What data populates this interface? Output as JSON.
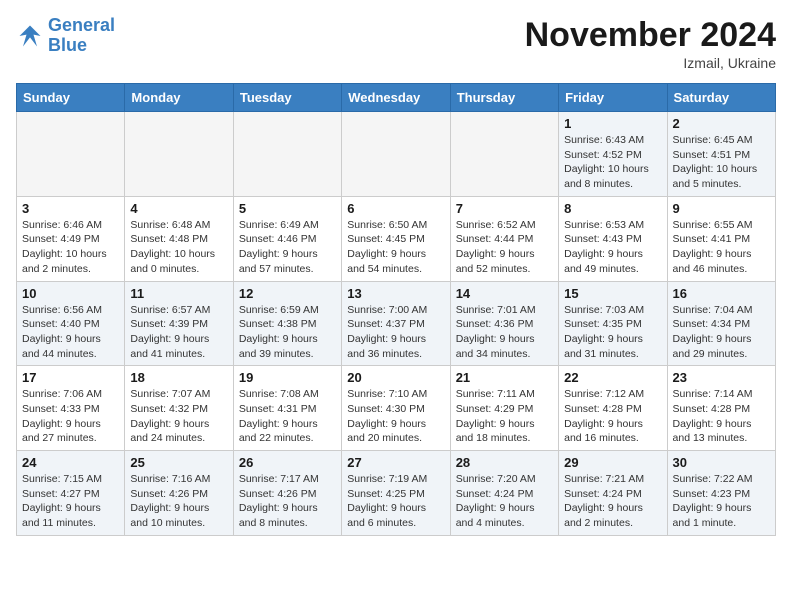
{
  "header": {
    "logo_line1": "General",
    "logo_line2": "Blue",
    "month": "November 2024",
    "location": "Izmail, Ukraine"
  },
  "weekdays": [
    "Sunday",
    "Monday",
    "Tuesday",
    "Wednesday",
    "Thursday",
    "Friday",
    "Saturday"
  ],
  "weeks": [
    [
      {
        "day": "",
        "info": ""
      },
      {
        "day": "",
        "info": ""
      },
      {
        "day": "",
        "info": ""
      },
      {
        "day": "",
        "info": ""
      },
      {
        "day": "",
        "info": ""
      },
      {
        "day": "1",
        "info": "Sunrise: 6:43 AM\nSunset: 4:52 PM\nDaylight: 10 hours and 8 minutes."
      },
      {
        "day": "2",
        "info": "Sunrise: 6:45 AM\nSunset: 4:51 PM\nDaylight: 10 hours and 5 minutes."
      }
    ],
    [
      {
        "day": "3",
        "info": "Sunrise: 6:46 AM\nSunset: 4:49 PM\nDaylight: 10 hours and 2 minutes."
      },
      {
        "day": "4",
        "info": "Sunrise: 6:48 AM\nSunset: 4:48 PM\nDaylight: 10 hours and 0 minutes."
      },
      {
        "day": "5",
        "info": "Sunrise: 6:49 AM\nSunset: 4:46 PM\nDaylight: 9 hours and 57 minutes."
      },
      {
        "day": "6",
        "info": "Sunrise: 6:50 AM\nSunset: 4:45 PM\nDaylight: 9 hours and 54 minutes."
      },
      {
        "day": "7",
        "info": "Sunrise: 6:52 AM\nSunset: 4:44 PM\nDaylight: 9 hours and 52 minutes."
      },
      {
        "day": "8",
        "info": "Sunrise: 6:53 AM\nSunset: 4:43 PM\nDaylight: 9 hours and 49 minutes."
      },
      {
        "day": "9",
        "info": "Sunrise: 6:55 AM\nSunset: 4:41 PM\nDaylight: 9 hours and 46 minutes."
      }
    ],
    [
      {
        "day": "10",
        "info": "Sunrise: 6:56 AM\nSunset: 4:40 PM\nDaylight: 9 hours and 44 minutes."
      },
      {
        "day": "11",
        "info": "Sunrise: 6:57 AM\nSunset: 4:39 PM\nDaylight: 9 hours and 41 minutes."
      },
      {
        "day": "12",
        "info": "Sunrise: 6:59 AM\nSunset: 4:38 PM\nDaylight: 9 hours and 39 minutes."
      },
      {
        "day": "13",
        "info": "Sunrise: 7:00 AM\nSunset: 4:37 PM\nDaylight: 9 hours and 36 minutes."
      },
      {
        "day": "14",
        "info": "Sunrise: 7:01 AM\nSunset: 4:36 PM\nDaylight: 9 hours and 34 minutes."
      },
      {
        "day": "15",
        "info": "Sunrise: 7:03 AM\nSunset: 4:35 PM\nDaylight: 9 hours and 31 minutes."
      },
      {
        "day": "16",
        "info": "Sunrise: 7:04 AM\nSunset: 4:34 PM\nDaylight: 9 hours and 29 minutes."
      }
    ],
    [
      {
        "day": "17",
        "info": "Sunrise: 7:06 AM\nSunset: 4:33 PM\nDaylight: 9 hours and 27 minutes."
      },
      {
        "day": "18",
        "info": "Sunrise: 7:07 AM\nSunset: 4:32 PM\nDaylight: 9 hours and 24 minutes."
      },
      {
        "day": "19",
        "info": "Sunrise: 7:08 AM\nSunset: 4:31 PM\nDaylight: 9 hours and 22 minutes."
      },
      {
        "day": "20",
        "info": "Sunrise: 7:10 AM\nSunset: 4:30 PM\nDaylight: 9 hours and 20 minutes."
      },
      {
        "day": "21",
        "info": "Sunrise: 7:11 AM\nSunset: 4:29 PM\nDaylight: 9 hours and 18 minutes."
      },
      {
        "day": "22",
        "info": "Sunrise: 7:12 AM\nSunset: 4:28 PM\nDaylight: 9 hours and 16 minutes."
      },
      {
        "day": "23",
        "info": "Sunrise: 7:14 AM\nSunset: 4:28 PM\nDaylight: 9 hours and 13 minutes."
      }
    ],
    [
      {
        "day": "24",
        "info": "Sunrise: 7:15 AM\nSunset: 4:27 PM\nDaylight: 9 hours and 11 minutes."
      },
      {
        "day": "25",
        "info": "Sunrise: 7:16 AM\nSunset: 4:26 PM\nDaylight: 9 hours and 10 minutes."
      },
      {
        "day": "26",
        "info": "Sunrise: 7:17 AM\nSunset: 4:26 PM\nDaylight: 9 hours and 8 minutes."
      },
      {
        "day": "27",
        "info": "Sunrise: 7:19 AM\nSunset: 4:25 PM\nDaylight: 9 hours and 6 minutes."
      },
      {
        "day": "28",
        "info": "Sunrise: 7:20 AM\nSunset: 4:24 PM\nDaylight: 9 hours and 4 minutes."
      },
      {
        "day": "29",
        "info": "Sunrise: 7:21 AM\nSunset: 4:24 PM\nDaylight: 9 hours and 2 minutes."
      },
      {
        "day": "30",
        "info": "Sunrise: 7:22 AM\nSunset: 4:23 PM\nDaylight: 9 hours and 1 minute."
      }
    ]
  ]
}
